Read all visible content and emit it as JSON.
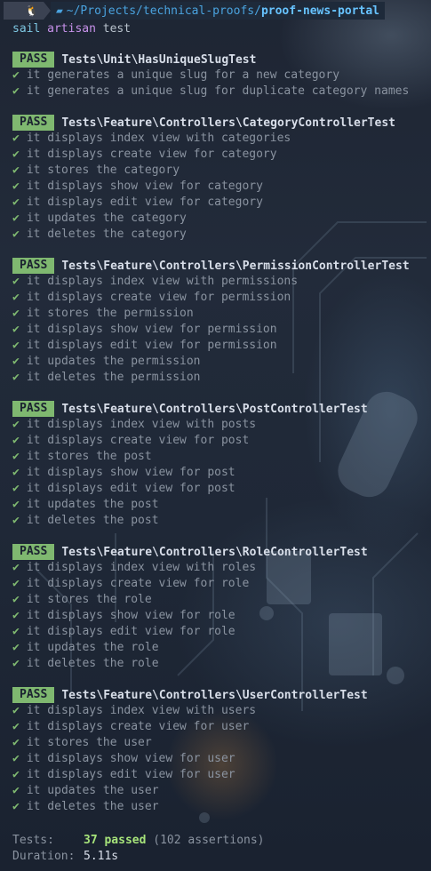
{
  "prompt": {
    "os_icon": "penguin-icon",
    "folder_icon": "folder-icon",
    "path": "~/Projects/technical-proofs/",
    "repo": "proof-news-portal"
  },
  "command": {
    "sail": "sail",
    "artisan": "artisan",
    "arg": "test"
  },
  "groups": [
    {
      "badge": "PASS",
      "suite": "Tests\\Unit\\HasUniqueSlugTest",
      "tests": [
        "it generates a unique slug for a new category",
        "it generates a unique slug for duplicate category names"
      ]
    },
    {
      "badge": "PASS",
      "suite": "Tests\\Feature\\Controllers\\CategoryControllerTest",
      "tests": [
        "it displays index view with categories",
        "it displays create view for category",
        "it stores the category",
        "it displays show view for category",
        "it displays edit view for category",
        "it updates the category",
        "it deletes the category"
      ]
    },
    {
      "badge": "PASS",
      "suite": "Tests\\Feature\\Controllers\\PermissionControllerTest",
      "tests": [
        "it displays index view with permissions",
        "it displays create view for permission",
        "it stores the permission",
        "it displays show view for permission",
        "it displays edit view for permission",
        "it updates the permission",
        "it deletes the permission"
      ]
    },
    {
      "badge": "PASS",
      "suite": "Tests\\Feature\\Controllers\\PostControllerTest",
      "tests": [
        "it displays index view with posts",
        "it displays create view for post",
        "it stores the post",
        "it displays show view for post",
        "it displays edit view for post",
        "it updates the post",
        "it deletes the post"
      ]
    },
    {
      "badge": "PASS",
      "suite": "Tests\\Feature\\Controllers\\RoleControllerTest",
      "tests": [
        "it displays index view with roles",
        "it displays create view for role",
        "it stores the role",
        "it displays show view for role",
        "it displays edit view for role",
        "it updates the role",
        "it deletes the role"
      ]
    },
    {
      "badge": "PASS",
      "suite": "Tests\\Feature\\Controllers\\UserControllerTest",
      "tests": [
        "it displays index view with users",
        "it displays create view for user",
        "it stores the user",
        "it displays show view for user",
        "it displays edit view for user",
        "it updates the user",
        "it deletes the user"
      ]
    }
  ],
  "check_glyph": "✔",
  "summary": {
    "tests_label": "Tests:",
    "passed": "37 passed",
    "assertions": "(102 assertions)",
    "duration_label": "Duration:",
    "duration": "5.11s"
  },
  "colors": {
    "pass_badge": "#7fb870",
    "check": "#7fb870",
    "passed_count": "#a6e37a",
    "dir_path": "#4aa3df",
    "artisan": "#c792ea"
  }
}
